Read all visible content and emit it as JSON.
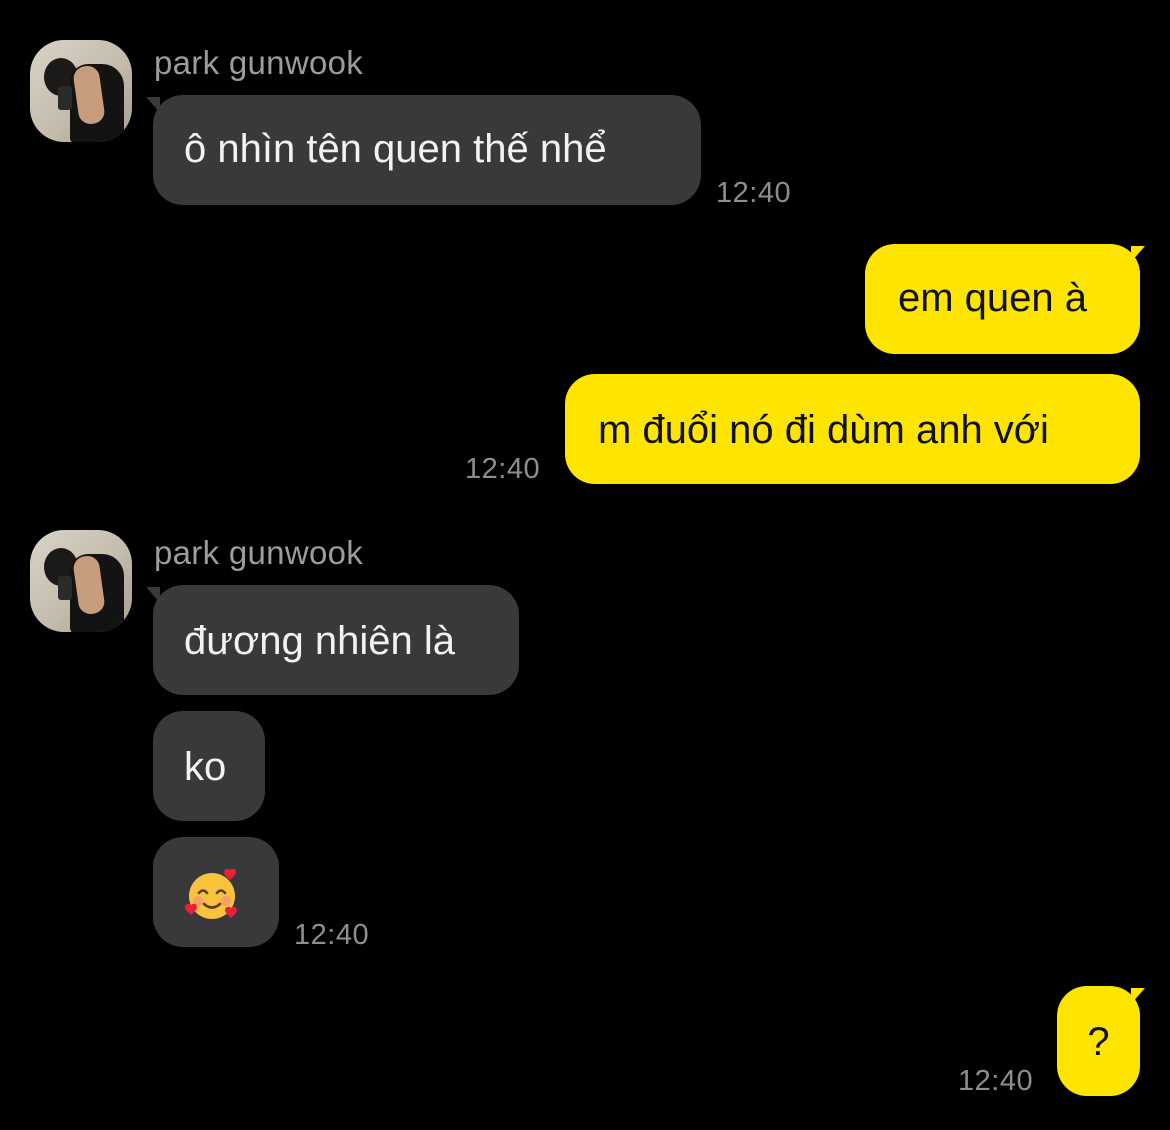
{
  "chat": {
    "messages": [
      {
        "sender": "park gunwook",
        "text": "ô nhìn tên quen thế nhể",
        "time": "12:40"
      },
      {
        "text": "em quen à"
      },
      {
        "text": "m đuổi nó đi dùm anh với",
        "time": "12:40"
      },
      {
        "sender": "park gunwook",
        "text": "đương nhiên là"
      },
      {
        "text": "ko"
      },
      {
        "emoji": "smiling-face-with-hearts-icon",
        "time": "12:40"
      },
      {
        "text": "?",
        "time": "12:40"
      }
    ]
  },
  "colors": {
    "background": "#000000",
    "incoming_bubble": "#39393b",
    "outgoing_bubble": "#fee500",
    "timestamp": "#8e8e8e",
    "sender_name": "#9c9c9c"
  }
}
